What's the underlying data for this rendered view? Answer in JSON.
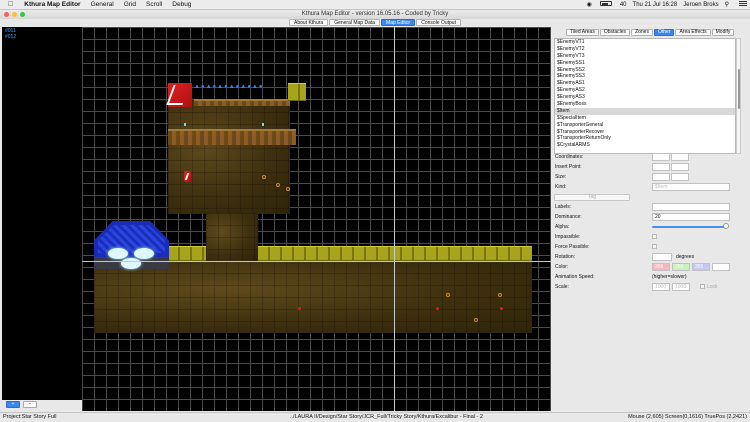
{
  "menubar": {
    "apple_icon": "apple-icon",
    "app_name": "Kthura Map Editor",
    "menus": [
      "General",
      "Grid",
      "Scroll",
      "Debug"
    ],
    "status": {
      "battery": "40",
      "clock": "Thu 21 Jul  16:28",
      "user": "Jeroen Broks"
    }
  },
  "window": {
    "title": "Kthura Map Editor - version 16.05.16 - Coded by Tricky",
    "close_color": "#fc605b",
    "min_color": "#fdbc40",
    "max_color": "#34c84a"
  },
  "top_tabs": [
    "About Kthura",
    "General Map Data",
    "Map Editor",
    "Console Output"
  ],
  "layers": {
    "items": [
      "#011",
      "#012"
    ],
    "add_label": "+",
    "remove_label": "-"
  },
  "panel": {
    "tabs": [
      "Tiled Areas",
      "Obstacles",
      "Zones",
      "Other",
      "Area Effects",
      "Modify"
    ],
    "kinds": [
      "$EnemyVT1",
      "$EnemyVT2",
      "$EnemyVT3",
      "$EnemySS1",
      "$EnemySS2",
      "$EnemySS3",
      "$EnemyAS1",
      "$EnemyAS2",
      "$EnemyAS3",
      "$EnemyBoss",
      "$Item",
      "$SpecialItem",
      "$TransporterGeneral",
      "$TransporterRecover",
      "$TransporterReturnOnly",
      "$CrystalARMS"
    ],
    "selected_kind": "$Item",
    "labels": {
      "coordinates": "Coordinates:",
      "insert_point": "Insert Point:",
      "size": "Size:",
      "kind": "Kind:",
      "labels": "Labels:",
      "dominance": "Dominance:",
      "alpha": "Alpha:",
      "impassible": "Impassible:",
      "force_passible": "Force Passible:",
      "rotation": "Rotation:",
      "degrees": "degrees",
      "color": "Color:",
      "animation_speed": "Animation Speed:",
      "anim_hint": "(higher=slower)",
      "scale": "Scale:",
      "lock": "Lock"
    },
    "kind_value": "$Item",
    "tag_button": "Tag",
    "dominance_value": "20",
    "color_values": [
      "255",
      "255",
      "255"
    ],
    "scale_values": [
      "1000",
      "1000"
    ],
    "alpha_fraction": 1.0
  },
  "map_status": {
    "project": "Project:Star Story Full",
    "path": "../LAURA II/Design/Star Story/JCR_Full/Tricky Story/Kthura/Excalibur - Final - 2",
    "mouse": "Mouse (2,605)  Screen(0,1616)  TruePos (2,2421)"
  }
}
